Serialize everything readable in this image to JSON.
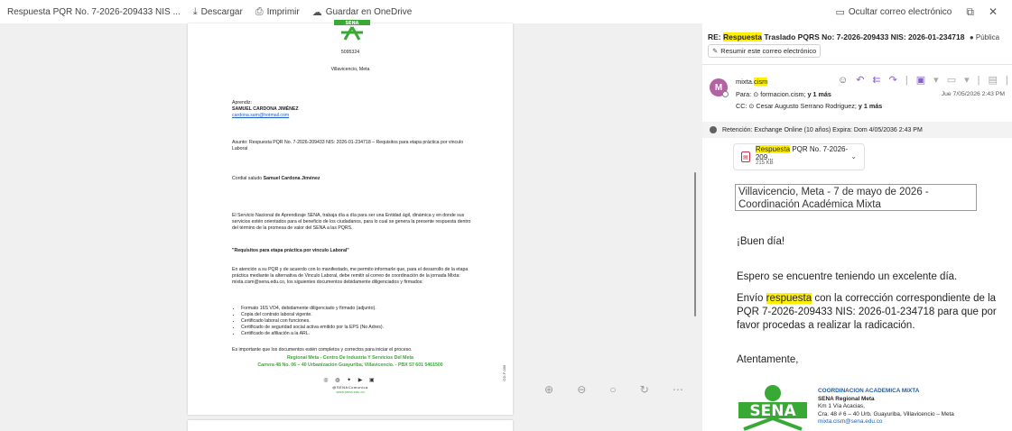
{
  "toolbar": {
    "file_name": "Respuesta PQR No. 7-2026-209433 NIS ...",
    "download": "Descargar",
    "print": "Imprimir",
    "save_onedrive": "Guardar en OneDrive",
    "hide_email": "Ocultar correo electrónico"
  },
  "document": {
    "sena_logo": "SENA",
    "code": "5095324",
    "city": "Villavicencio, Meta",
    "recipient_label": "Aprendiz:",
    "recipient_name": "SAMUEL CARDONA JIMÉNEZ",
    "recipient_email": "cardona.sam@hotmail.com",
    "subject": "Asunto:  Respuesta PQR No. 7-2026-209433 NIS: 2026-01-234718 – Requisitos para etapa práctica por vinculo Laboral",
    "greeting_prefix": "Cordial saludo ",
    "greeting_name": "Samuel Cardona Jiménez",
    "paragraph1": "El Servicio Nacional de Aprendizaje SENA, trabaja día a día para ser una Entidad ágil, dinámica y en donde sus servicios estén orientados para el beneficio de los ciudadanos, para lo cual se genera la presente respuesta dentro del término de la promesa de valor del SENA a las PQRS.",
    "heading": "\"Requisitos para etapa práctica por vinculo Laboral\"",
    "paragraph2": "En atención a su PQR y de acuerdo con lo manifestado, me permito informarle que, para el desarrollo de la etapa práctica mediante la alternativa de Vinculo Laboral, debe remitir al correo de coordinación de la jornada Mixta: mixta.cism@sena.edu.co, los siguientes documentos debidamente diligenciados y firmados:",
    "requirements": [
      "Formato 16S VO4, debidamente diligenciado y firmado (adjunto).",
      "Copia del contrato laboral vigente.",
      "Certificado laboral con funciones.",
      "Certificado de seguridad social activa emitido por la EPS (No Adres).",
      "Certificado de afiliación a la ARL."
    ],
    "closing": "Es importante que los documentos estén completos y correctos para iniciar el proceso.",
    "footer_line1": "Regional Meta - Centro De Industria Y Servicios Del Meta",
    "footer_line2": "Carrera 48 No. 06 – 40 Urbanización Guayuriba, Villavicencio. - PBX 57 601 5461500",
    "social_icons": "◎ ◍ ✦ ▶ ▣",
    "social_handle": "@SENAComunica",
    "social_web": "www.sena.edu.co",
    "side_code": "GD-F-009"
  },
  "email": {
    "subject_prefix": "RE: ",
    "subject_highlight": "Respuesta",
    "subject_rest": " Traslado PQRS No: 7-2026-209433 NIS: 2026-01-234718",
    "visibility": "Pública",
    "summarize": "Resumir este correo electrónico",
    "avatar_letter": "M",
    "sender_prefix": "mixta.",
    "sender_highlight": "cism",
    "to_label": "Para: ",
    "to_value": "formacion.cism;",
    "to_more": "y 1 más",
    "date": "Jue 7/05/2026 2:43 PM",
    "cc_label": "CC: ",
    "cc_value": "Cesar Augusto Serrano Rodriguez;",
    "cc_more": "y 1 más",
    "retention": "Retención: Exchange Online (10 años) Expira: Dom 4/05/2036 2:43 PM",
    "attachment_highlight": "Respuesta",
    "attachment_rest": " PQR No. 7-2026-209...",
    "attachment_size": "215 KB",
    "body_box": "Villavicencio, Meta - 7 de mayo de 2026 - Coordinación Académica Mixta",
    "greeting": "¡Buen día!",
    "line1": "Espero se encuentre teniendo un excelente día.",
    "line2_pre": "Envío ",
    "line2_highlight": "respuesta",
    "line2_post": " con la corrección correspondiente de la PQR  7-2026-209433 NIS: 2026-01-234718 para que por favor procedas a realizar la radicación.",
    "signoff": "Atentamente,",
    "sig_logo": "SENA",
    "sig_title": "COORDINACION ACADEMICA MIXTA",
    "sig_regional": "SENA Regional Meta",
    "sig_address1": "Km 1 Vía Acacias,",
    "sig_address2": "Cra. 48 # 6 – 40 Urb. Guayuriba, Villavicencio – Meta",
    "sig_email": "mixta.cism@sena.edu.co"
  }
}
